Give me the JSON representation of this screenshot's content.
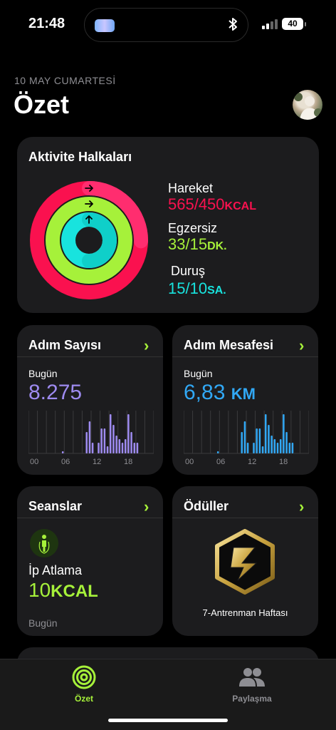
{
  "status_bar": {
    "time": "21:48",
    "battery": "40"
  },
  "header": {
    "date": "10 MAY CUMARTESİ",
    "title": "Özet"
  },
  "activity_rings": {
    "title": "Aktivite Halkaları",
    "move": {
      "label": "Hareket",
      "value": "565/450",
      "unit": "KCAL",
      "progress": 1.256,
      "color": "#fa114f"
    },
    "exercise": {
      "label": "Egzersiz",
      "value": "33/15",
      "unit": "DK.",
      "progress": 2.2,
      "color": "#a6f13a"
    },
    "stand": {
      "label": "Duruş",
      "value": "15/10",
      "unit": "SA.",
      "progress": 1.5,
      "color": "#18e3de"
    }
  },
  "steps": {
    "title": "Adım Sayısı",
    "day_label": "Bugün",
    "value": "8.275",
    "color": "#9e8bf0",
    "chart_data": {
      "type": "bar",
      "x_ticks": [
        "00",
        "06",
        "12",
        "18"
      ],
      "values": [
        0,
        0,
        0,
        0,
        0,
        0,
        0,
        0,
        0,
        0,
        0,
        3,
        0,
        0,
        0,
        0,
        0,
        0,
        0,
        30,
        45,
        15,
        0,
        15,
        35,
        35,
        10,
        55,
        40,
        25,
        20,
        15,
        20,
        55,
        30,
        15,
        15,
        0,
        0,
        0,
        0,
        0
      ]
    }
  },
  "distance": {
    "title": "Adım Mesafesi",
    "day_label": "Bugün",
    "value": "6,83",
    "unit": "KM",
    "color": "#31a8f5",
    "chart_data": {
      "type": "bar",
      "x_ticks": [
        "00",
        "06",
        "12",
        "18"
      ],
      "values": [
        0,
        0,
        0,
        0,
        0,
        0,
        0,
        0,
        0,
        0,
        0,
        3,
        0,
        0,
        0,
        0,
        0,
        0,
        0,
        30,
        45,
        15,
        0,
        15,
        35,
        35,
        10,
        55,
        40,
        25,
        20,
        15,
        20,
        55,
        30,
        15,
        15,
        0,
        0,
        0,
        0,
        0
      ]
    }
  },
  "sessions": {
    "title": "Seanslar",
    "workout": "İp Atlama",
    "value": "10",
    "unit": "KCAL",
    "when": "Bugün"
  },
  "awards": {
    "title": "Ödüller",
    "award_name": "7-Antrenman Haftası"
  },
  "tabbar": {
    "tab1": "Özet",
    "tab2": "Paylaşma"
  },
  "colors": {
    "accent": "#a6f13a",
    "card": "#1c1c1e"
  }
}
